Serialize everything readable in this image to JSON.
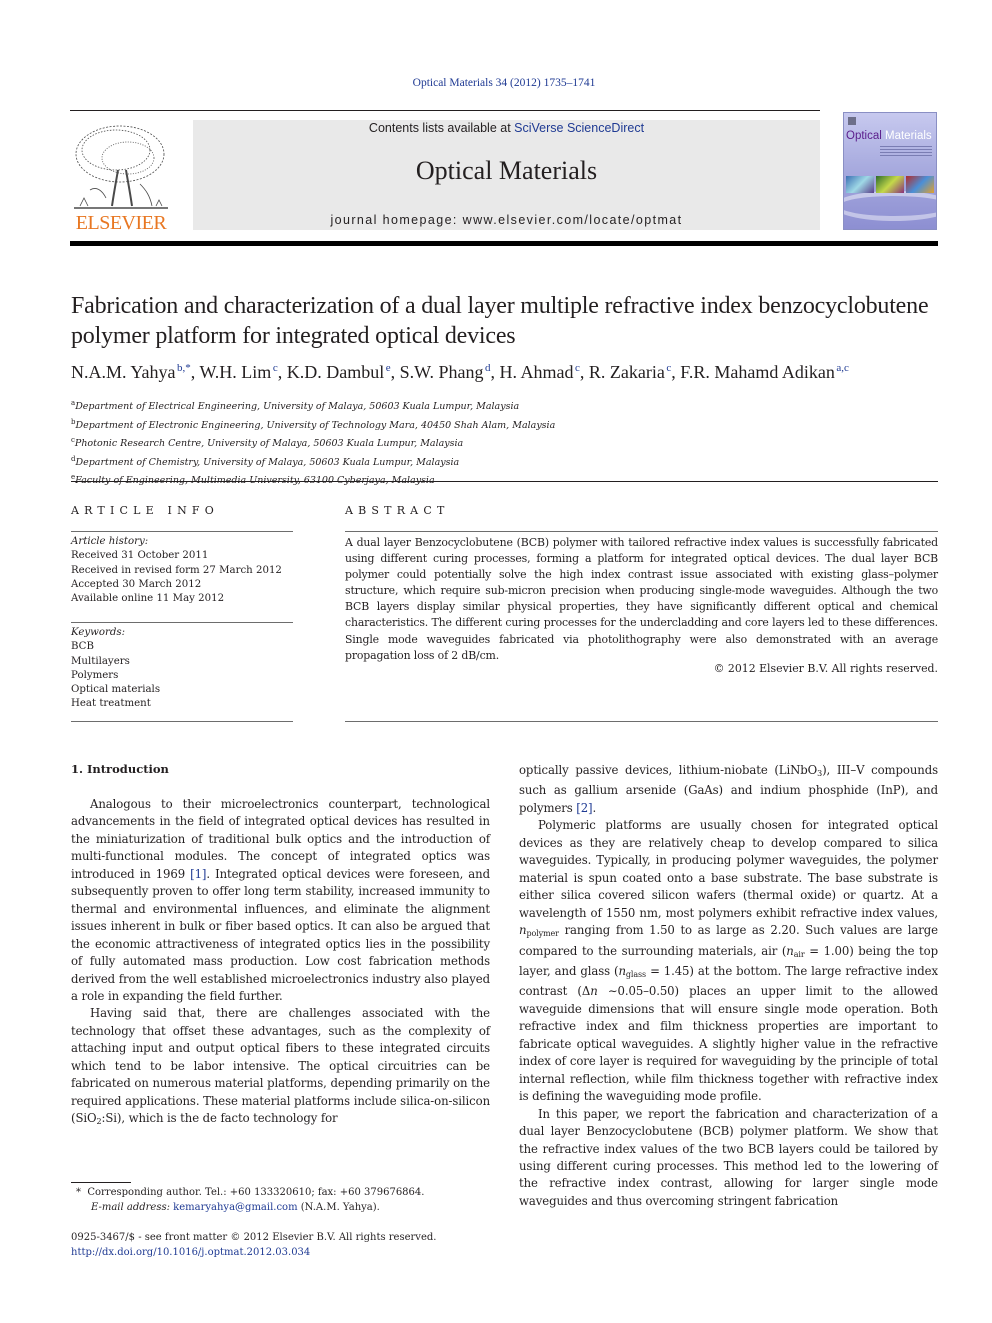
{
  "header": {
    "citation": "Optical Materials 34 (2012) 1735–1741",
    "contents_prefix": "Contents lists available at ",
    "contents_link": "SciVerse ScienceDirect",
    "journal_title": "Optical Materials",
    "homepage": "journal homepage: www.elsevier.com/locate/optmat",
    "publisher_logo_text": "ELSEVIER",
    "cover_title_part1": "Optical",
    "cover_title_part2": "Materials"
  },
  "colors": {
    "link": "#1f3a93",
    "elsevier_orange": "#e87722",
    "header_band": "#e9e9e9"
  },
  "article": {
    "title": "Fabrication and characterization of a dual layer multiple refractive index benzocyclobutene polymer platform for integrated optical devices",
    "authors": [
      {
        "name": "N.A.M. Yahya",
        "sup": "b,*",
        "sep": ", "
      },
      {
        "name": "W.H. Lim",
        "sup": "c",
        "sep": ", "
      },
      {
        "name": "K.D. Dambul",
        "sup": "e",
        "sep": ", "
      },
      {
        "name": "S.W. Phang",
        "sup": "d",
        "sep": ", "
      },
      {
        "name": "H. Ahmad",
        "sup": "c",
        "sep": ", "
      },
      {
        "name": "R. Zakaria",
        "sup": "c",
        "sep": ", "
      },
      {
        "name": "F.R. Mahamd Adikan",
        "sup": "a,c",
        "sep": ""
      }
    ],
    "affiliations": [
      {
        "key": "a",
        "text": "Department of Electrical Engineering, University of Malaya, 50603 Kuala Lumpur, Malaysia"
      },
      {
        "key": "b",
        "text": "Department of Electronic Engineering, University of Technology Mara, 40450 Shah Alam, Malaysia"
      },
      {
        "key": "c",
        "text": "Photonic Research Centre, University of Malaya, 50603 Kuala Lumpur, Malaysia"
      },
      {
        "key": "d",
        "text": "Department of Chemistry, University of Malaya, 50603 Kuala Lumpur, Malaysia"
      },
      {
        "key": "e",
        "text": "Faculty of Engineering, Multimedia University, 63100 Cyberjaya, Malaysia"
      }
    ]
  },
  "article_info": {
    "heading": "ARTICLE INFO",
    "history_label": "Article history:",
    "history": [
      "Received 31 October 2011",
      "Received in revised form 27 March 2012",
      "Accepted 30 March 2012",
      "Available online 11 May 2012"
    ],
    "keywords_label": "Keywords:",
    "keywords": [
      "BCB",
      "Multilayers",
      "Polymers",
      "Optical materials",
      "Heat treatment"
    ]
  },
  "abstract": {
    "heading": "ABSTRACT",
    "text": "A dual layer Benzocyclobutene (BCB) polymer with tailored refractive index values is successfully fabricated using different curing processes, forming a platform for integrated optical devices. The dual layer BCB polymer could potentially solve the high index contrast issue associated with existing glass–polymer structure, which require sub-micron precision when producing single-mode waveguides. Although the two BCB layers display similar physical properties, they have significantly different optical and chemical characteristics. The different curing processes for the undercladding and core layers led to these differences. Single mode waveguides fabricated via photolithography were also demonstrated with an average propagation loss of 2 dB/cm.",
    "copyright": "© 2012 Elsevier B.V. All rights reserved."
  },
  "body": {
    "section_heading": "1. Introduction",
    "left_p1_a": "Analogous to their microelectronics counterpart, technological advancements in the field of integrated optical devices has resulted in the miniaturization of traditional bulk optics and the introduction of multi-functional modules. The concept of integrated optics was introduced in 1969 ",
    "ref1": "[1]",
    "left_p1_b": ". Integrated optical devices were foreseen, and subsequently proven to offer long term stability, increased immunity to thermal and environmental influences, and eliminate the alignment issues inherent in bulk or fiber based optics. It can also be argued that the economic attractiveness of integrated optics lies in the possibility of fully automated mass production. Low cost fabrication methods derived from the well established microelectronics industry also played a role in expanding the field further.",
    "left_p2_a": "Having said that, there are challenges associated with the technology that offset these advantages, such as the complexity of attaching input and output optical fibers to these integrated circuits which tend to be labor intensive. The optical circuitries can be fabricated on numerous material platforms, depending primarily on the required applications. These material platforms include silica-on-silicon (SiO",
    "left_p2_sub": "2",
    "left_p2_b": ":Si), which is the de facto technology for",
    "right_p1_a": "optically passive devices, lithium-niobate (LiNbO",
    "right_p1_sub": "3",
    "right_p1_b": "), III–V compounds such as gallium arsenide (GaAs) and indium phosphide (InP), and polymers ",
    "ref2": "[2]",
    "right_p1_c": ".",
    "right_p2_a": "Polymeric platforms are usually chosen for integrated optical devices as they are relatively cheap to develop compared to silica waveguides. Typically, in producing polymer waveguides, the polymer material is spun coated onto a base substrate. The base substrate is either silica covered silicon wafers (thermal oxide) or quartz. At a wavelength of 1550 nm, most polymers exhibit refractive index values, ",
    "n_symbol": "n",
    "sub_polymer": "polymer",
    "right_p2_b": " ranging from 1.50 to as large as 2.20. Such values are large compared to the surrounding materials, air (",
    "sub_air": "air",
    "right_p2_c": " = 1.00) being the top layer, and glass (",
    "sub_glass": "glass",
    "right_p2_d": " = 1.45) at the bottom. The large refractive index contrast (Δ",
    "right_p2_e": " ∼0.05–0.50) places an upper limit to the allowed waveguide dimensions that will ensure single mode operation. Both refractive index and film thickness properties are important to fabricate optical waveguides. A slightly higher value in the refractive index of core layer is required for waveguiding by the principle of total internal reflection, while film thickness together with refractive index is defining the waveguiding mode profile.",
    "right_p3": "In this paper, we report the fabrication and characterization of a dual layer Benzocyclobutene (BCB) polymer platform. We show that the refractive index values of the two BCB layers could be tailored by using different curing processes. This method led to the lowering of the refractive index contrast, allowing for larger single mode waveguides and thus overcoming stringent fabrication"
  },
  "footnote": {
    "marker": "*",
    "corresponding": "Corresponding author. Tel.: +60 133320610; fax: +60 379676864.",
    "email_label": "E-mail address:",
    "email": "kemaryahya@gmail.com",
    "email_owner": " (N.A.M. Yahya)."
  },
  "front_matter": {
    "issn_line": "0925-3467/$ - see front matter © 2012 Elsevier B.V. All rights reserved.",
    "doi": "http://dx.doi.org/10.1016/j.optmat.2012.03.034"
  }
}
